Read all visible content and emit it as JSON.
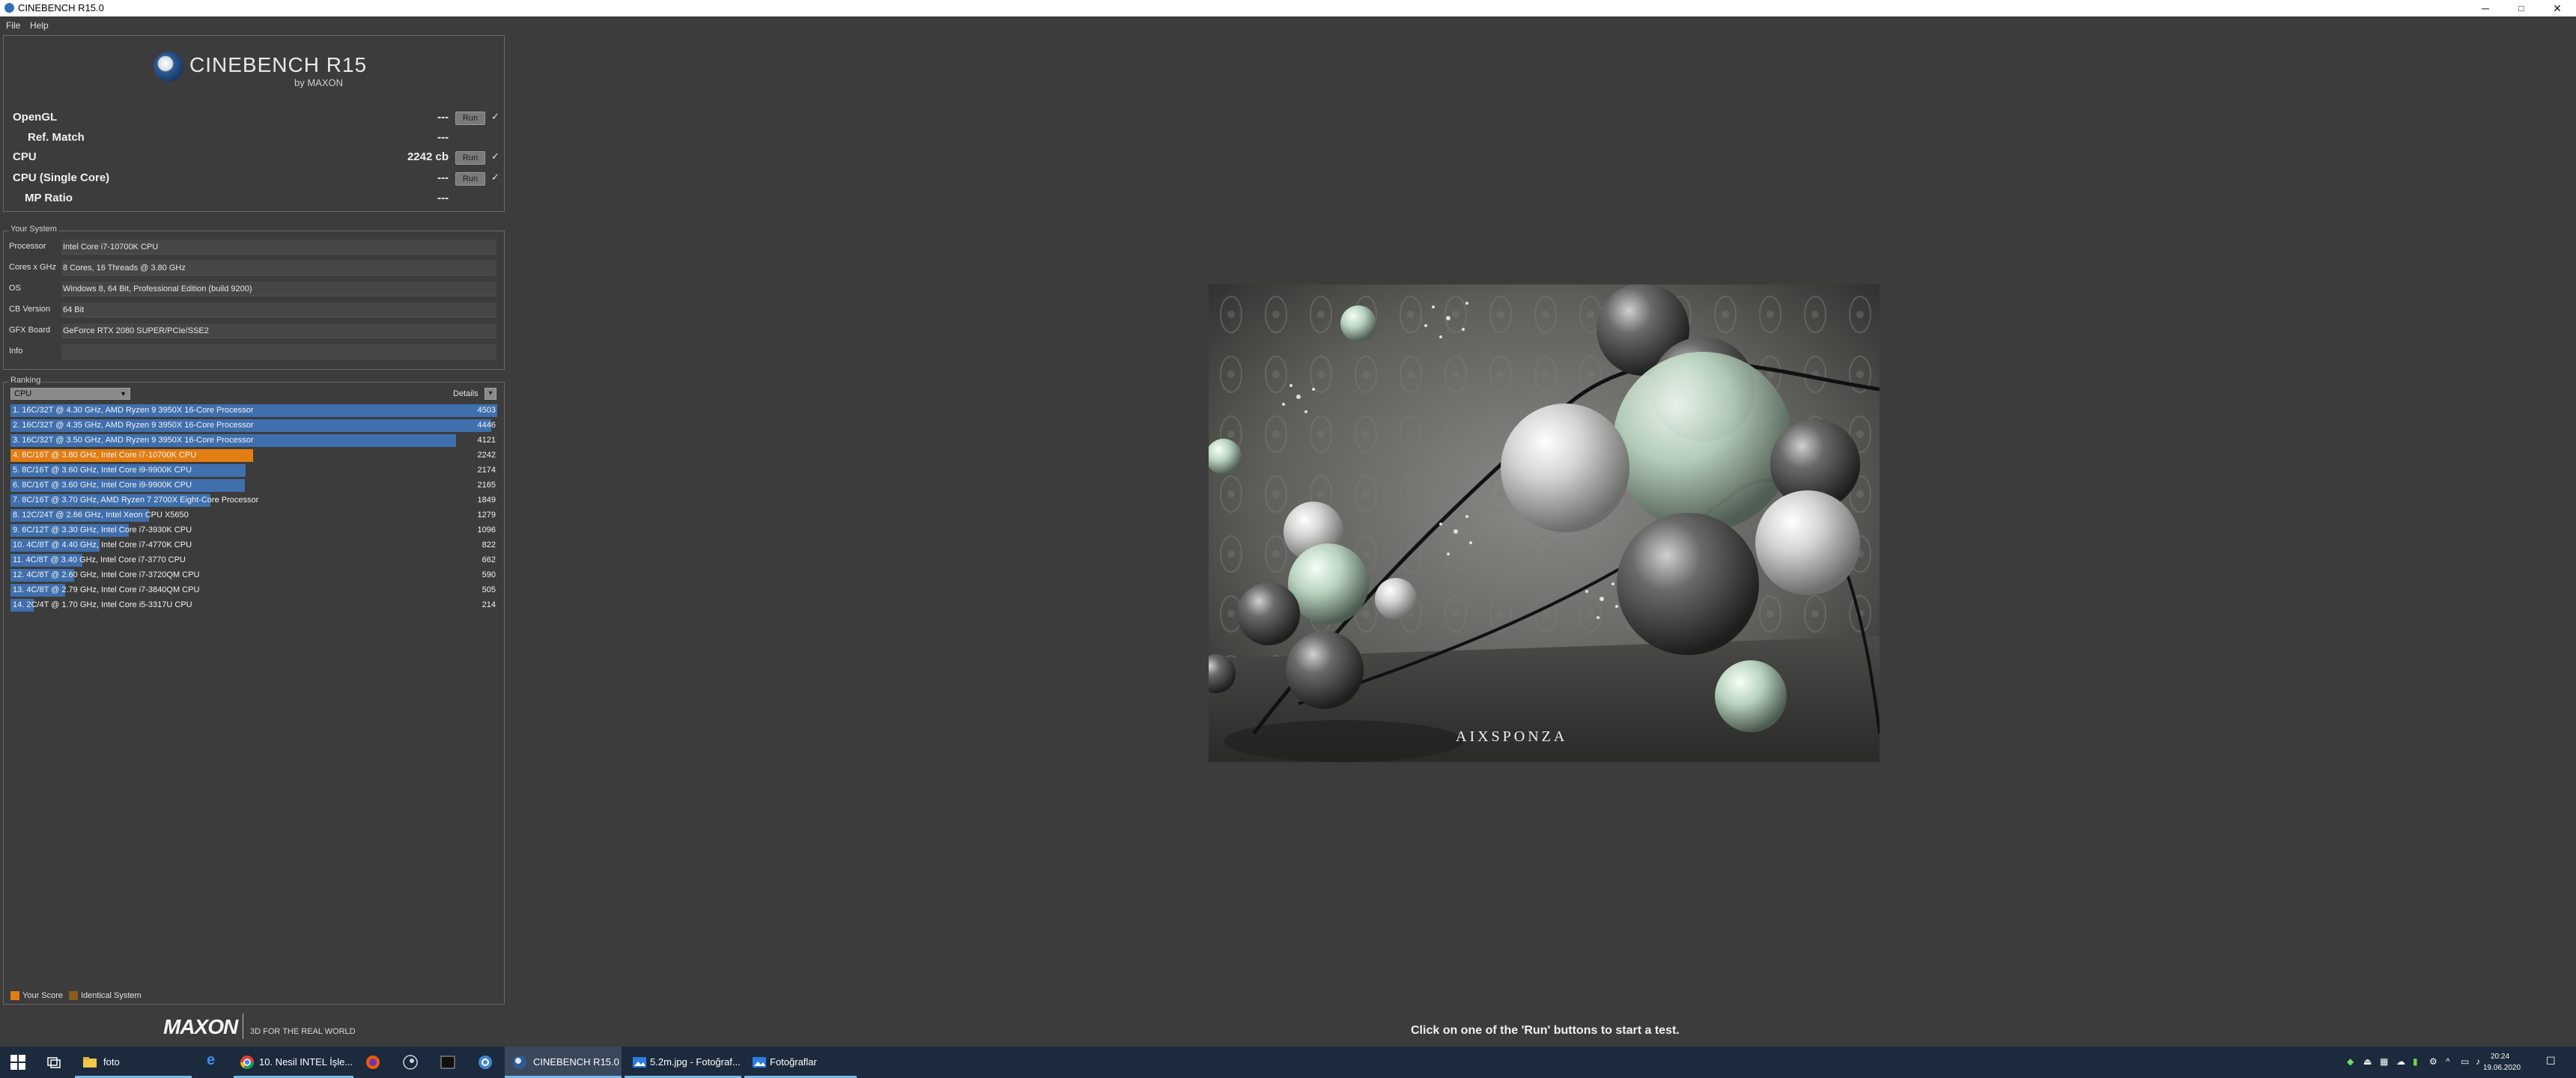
{
  "window": {
    "title": "CINEBENCH R15.0",
    "minimize": "─",
    "maximize": "□",
    "close": "✕"
  },
  "menu": {
    "file": "File",
    "help": "Help"
  },
  "logo": {
    "name": "CINEBENCH R15",
    "by": "by MAXON"
  },
  "benchmarks": [
    {
      "label": "OpenGL",
      "value": "---",
      "run": "Run",
      "check": "✓"
    },
    {
      "label": "Ref. Match",
      "value": "---"
    },
    {
      "label": "CPU",
      "value": "2242 cb",
      "run": "Run",
      "check": "✓"
    },
    {
      "label": "CPU (Single Core)",
      "value": "---",
      "run": "Run",
      "check": "✓"
    },
    {
      "label": "MP Ratio",
      "value": "---"
    }
  ],
  "your_system": {
    "title": "Your System",
    "rows": [
      {
        "label": "Processor",
        "value": "Intel Core i7-10700K CPU"
      },
      {
        "label": "Cores x GHz",
        "value": "8 Cores, 16 Threads @ 3.80 GHz"
      },
      {
        "label": "OS",
        "value": "Windows 8, 64 Bit, Professional Edition (build 9200)"
      },
      {
        "label": "CB Version",
        "value": "64 Bit"
      },
      {
        "label": "GFX Board",
        "value": "GeForce RTX 2080 SUPER/PCIe/SSE2"
      },
      {
        "label": "Info",
        "value": ""
      }
    ]
  },
  "ranking": {
    "title": "Ranking",
    "selected": "CPU",
    "details": "Details",
    "details_btn": "▾",
    "max_score": 4503,
    "rows": [
      {
        "label": "1. 16C/32T @ 4.30 GHz, AMD Ryzen 9 3950X 16-Core Processor",
        "score": 4503,
        "mine": false
      },
      {
        "label": "2. 16C/32T @ 4.35 GHz, AMD Ryzen 9 3950X 16-Core Processor",
        "score": 4446,
        "mine": false
      },
      {
        "label": "3. 16C/32T @ 3.50 GHz, AMD Ryzen 9 3950X 16-Core Processor",
        "score": 4121,
        "mine": false
      },
      {
        "label": "4. 8C/16T @ 3.80 GHz, Intel Core i7-10700K CPU",
        "score": 2242,
        "mine": true
      },
      {
        "label": "5. 8C/16T @ 3.60 GHz, Intel Core i9-9900K CPU",
        "score": 2174,
        "mine": false
      },
      {
        "label": "6. 8C/16T @ 3.60 GHz, Intel Core i9-9900K CPU",
        "score": 2165,
        "mine": false
      },
      {
        "label": "7. 8C/16T @ 3.70 GHz, AMD Ryzen 7 2700X Eight-Core Processor",
        "score": 1849,
        "mine": false
      },
      {
        "label": "8. 12C/24T @ 2.66 GHz, Intel Xeon CPU X5650",
        "score": 1279,
        "mine": false
      },
      {
        "label": "9. 6C/12T @ 3.30 GHz,  Intel Core i7-3930K CPU",
        "score": 1096,
        "mine": false
      },
      {
        "label": "10. 4C/8T @ 4.40 GHz, Intel Core i7-4770K CPU",
        "score": 822,
        "mine": false
      },
      {
        "label": "11. 4C/8T @ 3.40 GHz,  Intel Core i7-3770 CPU",
        "score": 662,
        "mine": false
      },
      {
        "label": "12. 4C/8T @ 2.60 GHz, Intel Core i7-3720QM CPU",
        "score": 590,
        "mine": false
      },
      {
        "label": "13. 4C/8T @ 2.79 GHz,  Intel Core i7-3840QM CPU",
        "score": 505,
        "mine": false
      },
      {
        "label": "14. 2C/4T @ 1.70 GHz,  Intel Core i5-3317U CPU",
        "score": 214,
        "mine": false
      }
    ]
  },
  "legend": {
    "your_score": "Your Score",
    "identical_system": "Identical System",
    "your_color": "#e17d12",
    "identical_color": "#8b5a1e"
  },
  "brand": {
    "name": "MAXON",
    "tagline": "3D FOR THE REAL WORLD"
  },
  "status": "Click on one of the 'Run' buttons to start a test.",
  "render": {
    "watermark": "AIXSPONZA"
  },
  "taskbar": {
    "items": [
      {
        "name": "start",
        "label": ""
      },
      {
        "name": "task-view",
        "label": ""
      },
      {
        "name": "explorer",
        "label": "foto"
      },
      {
        "name": "edge",
        "label": ""
      },
      {
        "name": "chrome",
        "label": "10. Nesil INTEL İşle..."
      },
      {
        "name": "firefox",
        "label": ""
      },
      {
        "name": "steam",
        "label": ""
      },
      {
        "name": "app-dark",
        "label": ""
      },
      {
        "name": "app-blue",
        "label": ""
      },
      {
        "name": "cinebench",
        "label": "CINEBENCH R15.0"
      },
      {
        "name": "photos1",
        "label": "5.2m.jpg - Fotoğraf..."
      },
      {
        "name": "photos2",
        "label": "Fotoğraflar"
      }
    ],
    "time": "20:24",
    "date": "19.06.2020"
  }
}
